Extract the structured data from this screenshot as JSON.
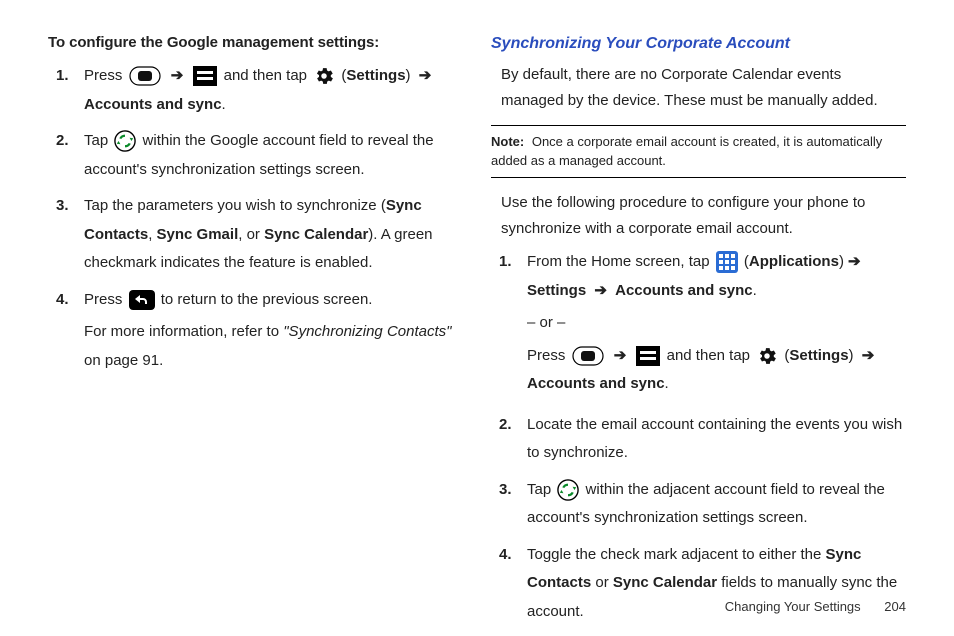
{
  "left": {
    "heading": "To configure the Google management settings:",
    "items": [
      {
        "num": "1.",
        "pre": "Press ",
        "mid": " and then tap ",
        "settings": "Settings",
        "tail": "Accounts and sync",
        "punct": "."
      },
      {
        "num": "2.",
        "pre": "Tap ",
        "post": " within the Google account field to reveal the account's synchronization settings screen."
      },
      {
        "num": "3.",
        "pre": "Tap the parameters you wish to synchronize (",
        "b1": "Sync Contacts",
        "sep1": ", ",
        "b2": "Sync Gmail",
        "sep2": ", or ",
        "b3": "Sync Calendar",
        "tail": "). A green checkmark indicates the feature is enabled."
      },
      {
        "num": "4.",
        "pre": "Press ",
        "post": " to return to the previous screen.",
        "extra1": "For more information, refer to ",
        "extra_i": "\"Synchronizing Contacts\"",
        "extra2": " on page 91."
      }
    ]
  },
  "right": {
    "heading": "Synchronizing Your Corporate Account",
    "intro": "By default, there are no Corporate Calendar events managed by the device. These must be manually added.",
    "note_label": "Note:",
    "note_body": "Once a corporate email account is created, it is automatically added as a managed account.",
    "lead": "Use the following procedure to configure your phone to synchronize with a corporate email account.",
    "items": [
      {
        "num": "1.",
        "a_pre": "From the Home screen, tap ",
        "a_apps": "Applications",
        "a_settings": "Settings",
        "a_accsync": "Accounts and sync",
        "or": "– or –",
        "b_pre": "Press ",
        "b_mid": " and then tap ",
        "b_settings": "Settings",
        "b_accsync": "Accounts and sync"
      },
      {
        "num": "2.",
        "text": "Locate the email account containing the events you wish to synchronize."
      },
      {
        "num": "3.",
        "pre": "Tap ",
        "post": " within the adjacent account field to reveal the account's synchronization settings screen."
      },
      {
        "num": "4.",
        "pre": "Toggle the check mark adjacent to either the ",
        "b1": "Sync Contacts",
        "mid": " or ",
        "b2": "Sync Calendar",
        "post": " fields to manually sync the account."
      }
    ]
  },
  "footer": {
    "section": "Changing Your Settings",
    "page": "204"
  },
  "glyphs": {
    "arrow": "➔",
    "paren_open": "(",
    "paren_close": ")",
    "period": "."
  }
}
